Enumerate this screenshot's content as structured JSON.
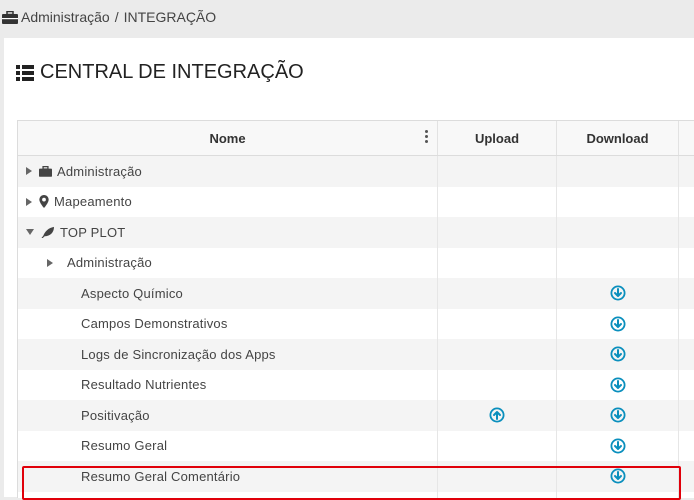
{
  "breadcrumb": {
    "section": "Administração",
    "separator": "/",
    "page": "INTEGRAÇÃO"
  },
  "page_title": "CENTRAL DE INTEGRAÇÃO",
  "table": {
    "columns": {
      "name": "Nome",
      "upload": "Upload",
      "download": "Download"
    },
    "rows": [
      {
        "label": "Administração",
        "level": 0,
        "toggle": "collapsed",
        "icon": "briefcase-icon",
        "upload": false,
        "download": false
      },
      {
        "label": "Mapeamento",
        "level": 0,
        "toggle": "collapsed",
        "icon": "map-marker-icon",
        "upload": false,
        "download": false
      },
      {
        "label": "TOP PLOT",
        "level": 0,
        "toggle": "expanded",
        "icon": "leaf-icon",
        "upload": false,
        "download": false
      },
      {
        "label": "Administração",
        "level": 1,
        "toggle": "collapsed",
        "icon": "",
        "upload": false,
        "download": false
      },
      {
        "label": "Aspecto Químico",
        "level": 2,
        "toggle": "",
        "icon": "",
        "upload": false,
        "download": true
      },
      {
        "label": "Campos Demonstrativos",
        "level": 2,
        "toggle": "",
        "icon": "",
        "upload": false,
        "download": true
      },
      {
        "label": "Logs de Sincronização dos Apps",
        "level": 2,
        "toggle": "",
        "icon": "",
        "upload": false,
        "download": true
      },
      {
        "label": "Resultado Nutrientes",
        "level": 2,
        "toggle": "",
        "icon": "",
        "upload": false,
        "download": true
      },
      {
        "label": "Positivação",
        "level": 2,
        "toggle": "",
        "icon": "",
        "upload": true,
        "download": true
      },
      {
        "label": "Resumo Geral",
        "level": 2,
        "toggle": "",
        "icon": "",
        "upload": false,
        "download": true,
        "highlighted": true
      },
      {
        "label": "Resumo Geral Comentário",
        "level": 2,
        "toggle": "",
        "icon": "",
        "upload": false,
        "download": true
      },
      {
        "label": "",
        "level": 2,
        "toggle": "",
        "icon": "",
        "upload": false,
        "download": true
      }
    ]
  },
  "colors": {
    "accent": "#0a8fbd",
    "highlight_border": "#e0000a",
    "row_alt": "#f4f4f4"
  }
}
